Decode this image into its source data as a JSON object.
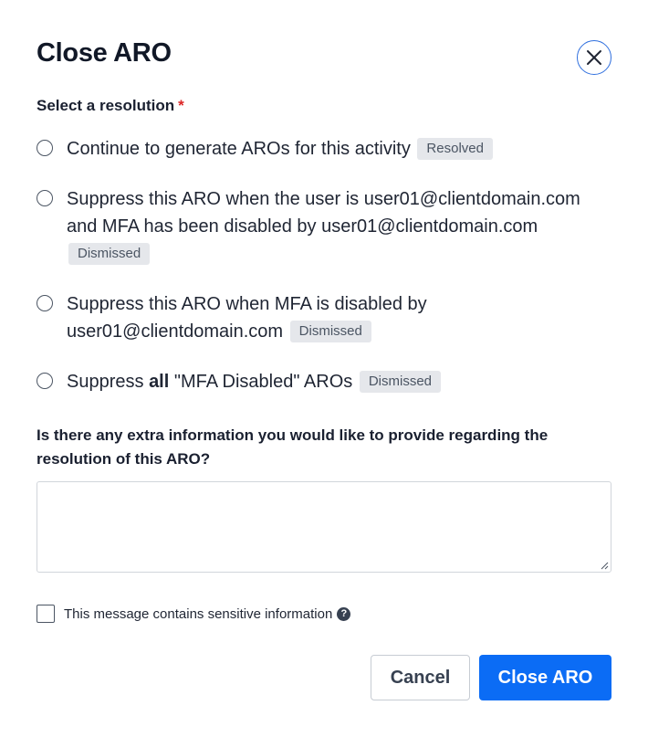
{
  "modal": {
    "title": "Close ARO",
    "close_icon": "close-icon"
  },
  "resolution": {
    "label": "Select a resolution",
    "required_marker": "*",
    "options": [
      {
        "text": "Continue to generate AROs for this activity",
        "badge": "Resolved",
        "selected": false
      },
      {
        "text_line1": "Suppress this ARO when the user is user01@clientdomain.com",
        "text_line2": "and MFA has been disabled by user01@clientdomain.com",
        "badge": "Dismissed",
        "selected": false
      },
      {
        "text_line1": "Suppress this ARO when MFA is disabled by",
        "text_line2": "user01@clientdomain.com",
        "badge": "Dismissed",
        "selected": false
      },
      {
        "text_prefix": "Suppress",
        "text_bold": "all",
        "text_suffix": "\"MFA Disabled\" AROs",
        "badge": "Dismissed",
        "selected": false
      }
    ]
  },
  "extra_info": {
    "question": "Is there any extra information you would like to provide regarding the resolution of this ARO?",
    "value": "",
    "placeholder": ""
  },
  "sensitive": {
    "label": "This message contains sensitive information",
    "checked": false,
    "help_icon": "question-circle-icon",
    "help_glyph": "?"
  },
  "actions": {
    "cancel_label": "Cancel",
    "submit_label": "Close ARO"
  },
  "colors": {
    "primary": "#0b6cf5",
    "close_ring": "#2f6fde",
    "required": "#dc2626",
    "badge_bg": "#e5e7eb"
  }
}
